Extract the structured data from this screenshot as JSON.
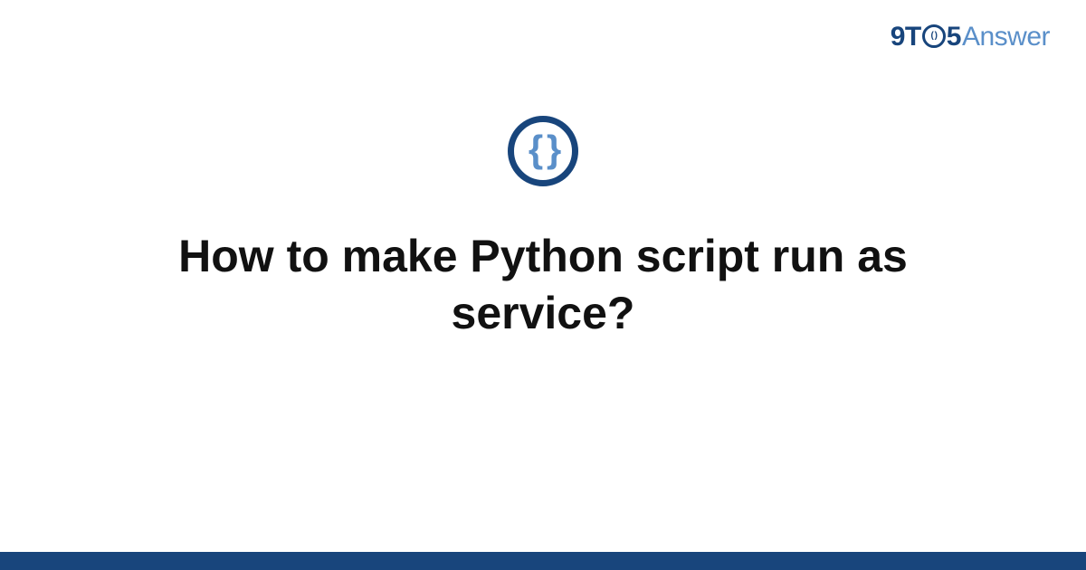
{
  "logo": {
    "part1": "9T",
    "circle_inner": "( )",
    "part2": "5",
    "part3": "Answer"
  },
  "badge": {
    "glyph": "{ }"
  },
  "title": "How to make Python script run as service?",
  "colors": {
    "brand_dark": "#18457c",
    "brand_light": "#5a8fc9"
  }
}
